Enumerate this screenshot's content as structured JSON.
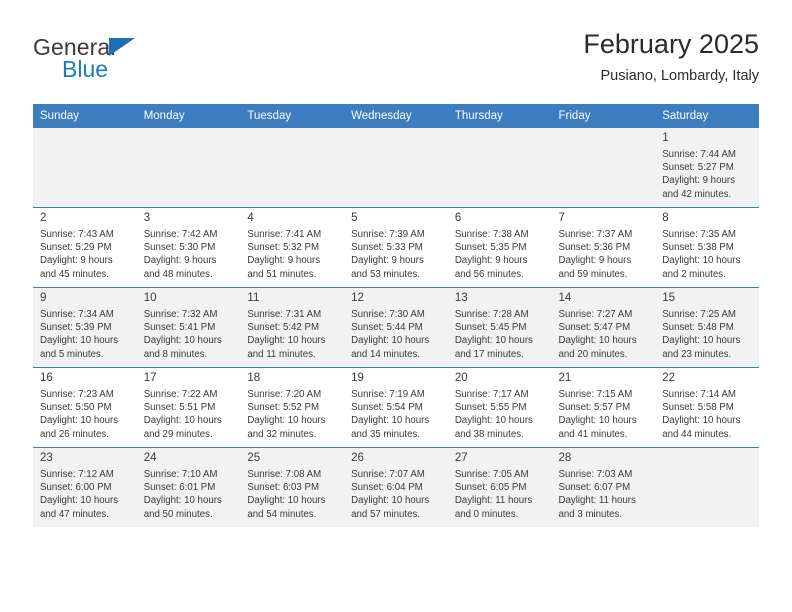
{
  "brand": {
    "name_top": "General",
    "name_bottom": "Blue",
    "triangle_icon": "blue-triangle-logo"
  },
  "header": {
    "title": "February 2025",
    "subtitle": "Pusiano, Lombardy, Italy"
  },
  "colors": {
    "header_blue": "#3b7dbf",
    "brand_blue": "#1b7ac4",
    "cell_shade": "#f2f2f2",
    "text": "#3a3a3a"
  },
  "weekday_headers": [
    "Sunday",
    "Monday",
    "Tuesday",
    "Wednesday",
    "Thursday",
    "Friday",
    "Saturday"
  ],
  "labels": {
    "sunrise_prefix": "Sunrise:",
    "sunset_prefix": "Sunset:",
    "daylight_prefix": "Daylight:"
  },
  "weeks": [
    [
      {
        "day": "",
        "empty": true
      },
      {
        "day": "",
        "empty": true
      },
      {
        "day": "",
        "empty": true
      },
      {
        "day": "",
        "empty": true
      },
      {
        "day": "",
        "empty": true
      },
      {
        "day": "",
        "empty": true
      },
      {
        "day": "1",
        "sunrise": "Sunrise: 7:44 AM",
        "sunset": "Sunset: 5:27 PM",
        "daylight_line1": "Daylight: 9 hours",
        "daylight_line2": "and 42 minutes."
      }
    ],
    [
      {
        "day": "2",
        "sunrise": "Sunrise: 7:43 AM",
        "sunset": "Sunset: 5:29 PM",
        "daylight_line1": "Daylight: 9 hours",
        "daylight_line2": "and 45 minutes."
      },
      {
        "day": "3",
        "sunrise": "Sunrise: 7:42 AM",
        "sunset": "Sunset: 5:30 PM",
        "daylight_line1": "Daylight: 9 hours",
        "daylight_line2": "and 48 minutes."
      },
      {
        "day": "4",
        "sunrise": "Sunrise: 7:41 AM",
        "sunset": "Sunset: 5:32 PM",
        "daylight_line1": "Daylight: 9 hours",
        "daylight_line2": "and 51 minutes."
      },
      {
        "day": "5",
        "sunrise": "Sunrise: 7:39 AM",
        "sunset": "Sunset: 5:33 PM",
        "daylight_line1": "Daylight: 9 hours",
        "daylight_line2": "and 53 minutes."
      },
      {
        "day": "6",
        "sunrise": "Sunrise: 7:38 AM",
        "sunset": "Sunset: 5:35 PM",
        "daylight_line1": "Daylight: 9 hours",
        "daylight_line2": "and 56 minutes."
      },
      {
        "day": "7",
        "sunrise": "Sunrise: 7:37 AM",
        "sunset": "Sunset: 5:36 PM",
        "daylight_line1": "Daylight: 9 hours",
        "daylight_line2": "and 59 minutes."
      },
      {
        "day": "8",
        "sunrise": "Sunrise: 7:35 AM",
        "sunset": "Sunset: 5:38 PM",
        "daylight_line1": "Daylight: 10 hours",
        "daylight_line2": "and 2 minutes."
      }
    ],
    [
      {
        "day": "9",
        "sunrise": "Sunrise: 7:34 AM",
        "sunset": "Sunset: 5:39 PM",
        "daylight_line1": "Daylight: 10 hours",
        "daylight_line2": "and 5 minutes."
      },
      {
        "day": "10",
        "sunrise": "Sunrise: 7:32 AM",
        "sunset": "Sunset: 5:41 PM",
        "daylight_line1": "Daylight: 10 hours",
        "daylight_line2": "and 8 minutes."
      },
      {
        "day": "11",
        "sunrise": "Sunrise: 7:31 AM",
        "sunset": "Sunset: 5:42 PM",
        "daylight_line1": "Daylight: 10 hours",
        "daylight_line2": "and 11 minutes."
      },
      {
        "day": "12",
        "sunrise": "Sunrise: 7:30 AM",
        "sunset": "Sunset: 5:44 PM",
        "daylight_line1": "Daylight: 10 hours",
        "daylight_line2": "and 14 minutes."
      },
      {
        "day": "13",
        "sunrise": "Sunrise: 7:28 AM",
        "sunset": "Sunset: 5:45 PM",
        "daylight_line1": "Daylight: 10 hours",
        "daylight_line2": "and 17 minutes."
      },
      {
        "day": "14",
        "sunrise": "Sunrise: 7:27 AM",
        "sunset": "Sunset: 5:47 PM",
        "daylight_line1": "Daylight: 10 hours",
        "daylight_line2": "and 20 minutes."
      },
      {
        "day": "15",
        "sunrise": "Sunrise: 7:25 AM",
        "sunset": "Sunset: 5:48 PM",
        "daylight_line1": "Daylight: 10 hours",
        "daylight_line2": "and 23 minutes."
      }
    ],
    [
      {
        "day": "16",
        "sunrise": "Sunrise: 7:23 AM",
        "sunset": "Sunset: 5:50 PM",
        "daylight_line1": "Daylight: 10 hours",
        "daylight_line2": "and 26 minutes."
      },
      {
        "day": "17",
        "sunrise": "Sunrise: 7:22 AM",
        "sunset": "Sunset: 5:51 PM",
        "daylight_line1": "Daylight: 10 hours",
        "daylight_line2": "and 29 minutes."
      },
      {
        "day": "18",
        "sunrise": "Sunrise: 7:20 AM",
        "sunset": "Sunset: 5:52 PM",
        "daylight_line1": "Daylight: 10 hours",
        "daylight_line2": "and 32 minutes."
      },
      {
        "day": "19",
        "sunrise": "Sunrise: 7:19 AM",
        "sunset": "Sunset: 5:54 PM",
        "daylight_line1": "Daylight: 10 hours",
        "daylight_line2": "and 35 minutes."
      },
      {
        "day": "20",
        "sunrise": "Sunrise: 7:17 AM",
        "sunset": "Sunset: 5:55 PM",
        "daylight_line1": "Daylight: 10 hours",
        "daylight_line2": "and 38 minutes."
      },
      {
        "day": "21",
        "sunrise": "Sunrise: 7:15 AM",
        "sunset": "Sunset: 5:57 PM",
        "daylight_line1": "Daylight: 10 hours",
        "daylight_line2": "and 41 minutes."
      },
      {
        "day": "22",
        "sunrise": "Sunrise: 7:14 AM",
        "sunset": "Sunset: 5:58 PM",
        "daylight_line1": "Daylight: 10 hours",
        "daylight_line2": "and 44 minutes."
      }
    ],
    [
      {
        "day": "23",
        "sunrise": "Sunrise: 7:12 AM",
        "sunset": "Sunset: 6:00 PM",
        "daylight_line1": "Daylight: 10 hours",
        "daylight_line2": "and 47 minutes."
      },
      {
        "day": "24",
        "sunrise": "Sunrise: 7:10 AM",
        "sunset": "Sunset: 6:01 PM",
        "daylight_line1": "Daylight: 10 hours",
        "daylight_line2": "and 50 minutes."
      },
      {
        "day": "25",
        "sunrise": "Sunrise: 7:08 AM",
        "sunset": "Sunset: 6:03 PM",
        "daylight_line1": "Daylight: 10 hours",
        "daylight_line2": "and 54 minutes."
      },
      {
        "day": "26",
        "sunrise": "Sunrise: 7:07 AM",
        "sunset": "Sunset: 6:04 PM",
        "daylight_line1": "Daylight: 10 hours",
        "daylight_line2": "and 57 minutes."
      },
      {
        "day": "27",
        "sunrise": "Sunrise: 7:05 AM",
        "sunset": "Sunset: 6:05 PM",
        "daylight_line1": "Daylight: 11 hours",
        "daylight_line2": "and 0 minutes."
      },
      {
        "day": "28",
        "sunrise": "Sunrise: 7:03 AM",
        "sunset": "Sunset: 6:07 PM",
        "daylight_line1": "Daylight: 11 hours",
        "daylight_line2": "and 3 minutes."
      },
      {
        "day": "",
        "empty": true
      }
    ]
  ]
}
